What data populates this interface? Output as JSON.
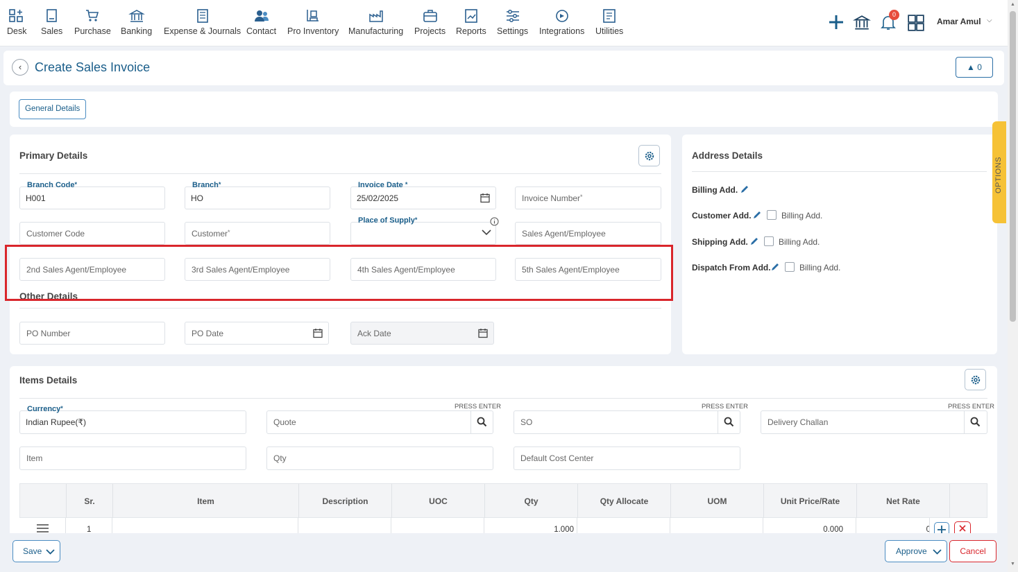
{
  "nav": {
    "items": [
      {
        "label": "Desk",
        "icon": "desk-icon"
      },
      {
        "label": "Sales",
        "icon": "sales-icon"
      },
      {
        "label": "Purchase",
        "icon": "cart-icon"
      },
      {
        "label": "Banking",
        "icon": "bank-icon"
      },
      {
        "label": "Expense & Journals",
        "icon": "journal-icon"
      },
      {
        "label": "Contact",
        "icon": "contact-icon"
      },
      {
        "label": "Pro Inventory",
        "icon": "inventory-icon"
      },
      {
        "label": "Manufacturing",
        "icon": "manufacturing-icon"
      },
      {
        "label": "Projects",
        "icon": "projects-icon"
      },
      {
        "label": "Reports",
        "icon": "reports-icon"
      },
      {
        "label": "Settings",
        "icon": "settings-icon"
      },
      {
        "label": "Integrations",
        "icon": "integrations-icon"
      },
      {
        "label": "Utilities",
        "icon": "utilities-icon"
      }
    ],
    "notification_count": "0",
    "user_name": "Amar Amul"
  },
  "header": {
    "title": "Create Sales Invoice",
    "upload_count": "0"
  },
  "tabs": {
    "general": "General Details"
  },
  "primary": {
    "title": "Primary Details",
    "branch_code_label": "Branch Code",
    "branch_code_value": "H001",
    "branch_label": "Branch",
    "branch_value": "HO",
    "invoice_date_label": "Invoice Date",
    "invoice_date_value": "25/02/2025",
    "invoice_number_ph": "Invoice Number",
    "customer_code_ph": "Customer Code",
    "customer_ph": "Customer",
    "place_of_supply_label": "Place of Supply",
    "sales_agent_ph": "Sales Agent/Employee",
    "agent2_ph": "2nd Sales Agent/Employee",
    "agent3_ph": "3rd Sales Agent/Employee",
    "agent4_ph": "4th Sales Agent/Employee",
    "agent5_ph": "5th Sales Agent/Employee",
    "other_title": "Other Details",
    "po_number_ph": "PO Number",
    "po_date_ph": "PO Date",
    "ack_date_ph": "Ack Date",
    "required_mark": "*"
  },
  "address": {
    "title": "Address Details",
    "billing": "Billing Add.",
    "customer": "Customer Add.",
    "shipping": "Shipping Add.",
    "dispatch": "Dispatch From Add.",
    "same_as_billing": "Billing Add."
  },
  "options_tab": "OPTIONS",
  "items": {
    "title": "Items Details",
    "currency_label": "Currency",
    "currency_value": "Indian Rupee(₹)",
    "press_enter": "PRESS ENTER",
    "quote_ph": "Quote",
    "so_ph": "SO",
    "delivery_challan_ph": "Delivery Challan",
    "item_ph": "Item",
    "qty_ph": "Qty",
    "cost_center_ph": "Default Cost Center",
    "columns": [
      "Sr.",
      "Item",
      "Description",
      "UOC",
      "Qty",
      "Qty Allocate",
      "UOM",
      "Unit Price/Rate",
      "Net Rate"
    ],
    "rows": [
      {
        "sr": "1",
        "qty": "1.000",
        "unit_price": "0.000",
        "net_rate": "0"
      }
    ]
  },
  "footer": {
    "save": "Save",
    "approve": "Approve",
    "cancel": "Cancel"
  },
  "colors": {
    "accent": "#1a5e8a",
    "highlight": "#d9252b",
    "options_tab": "#f6c236"
  }
}
